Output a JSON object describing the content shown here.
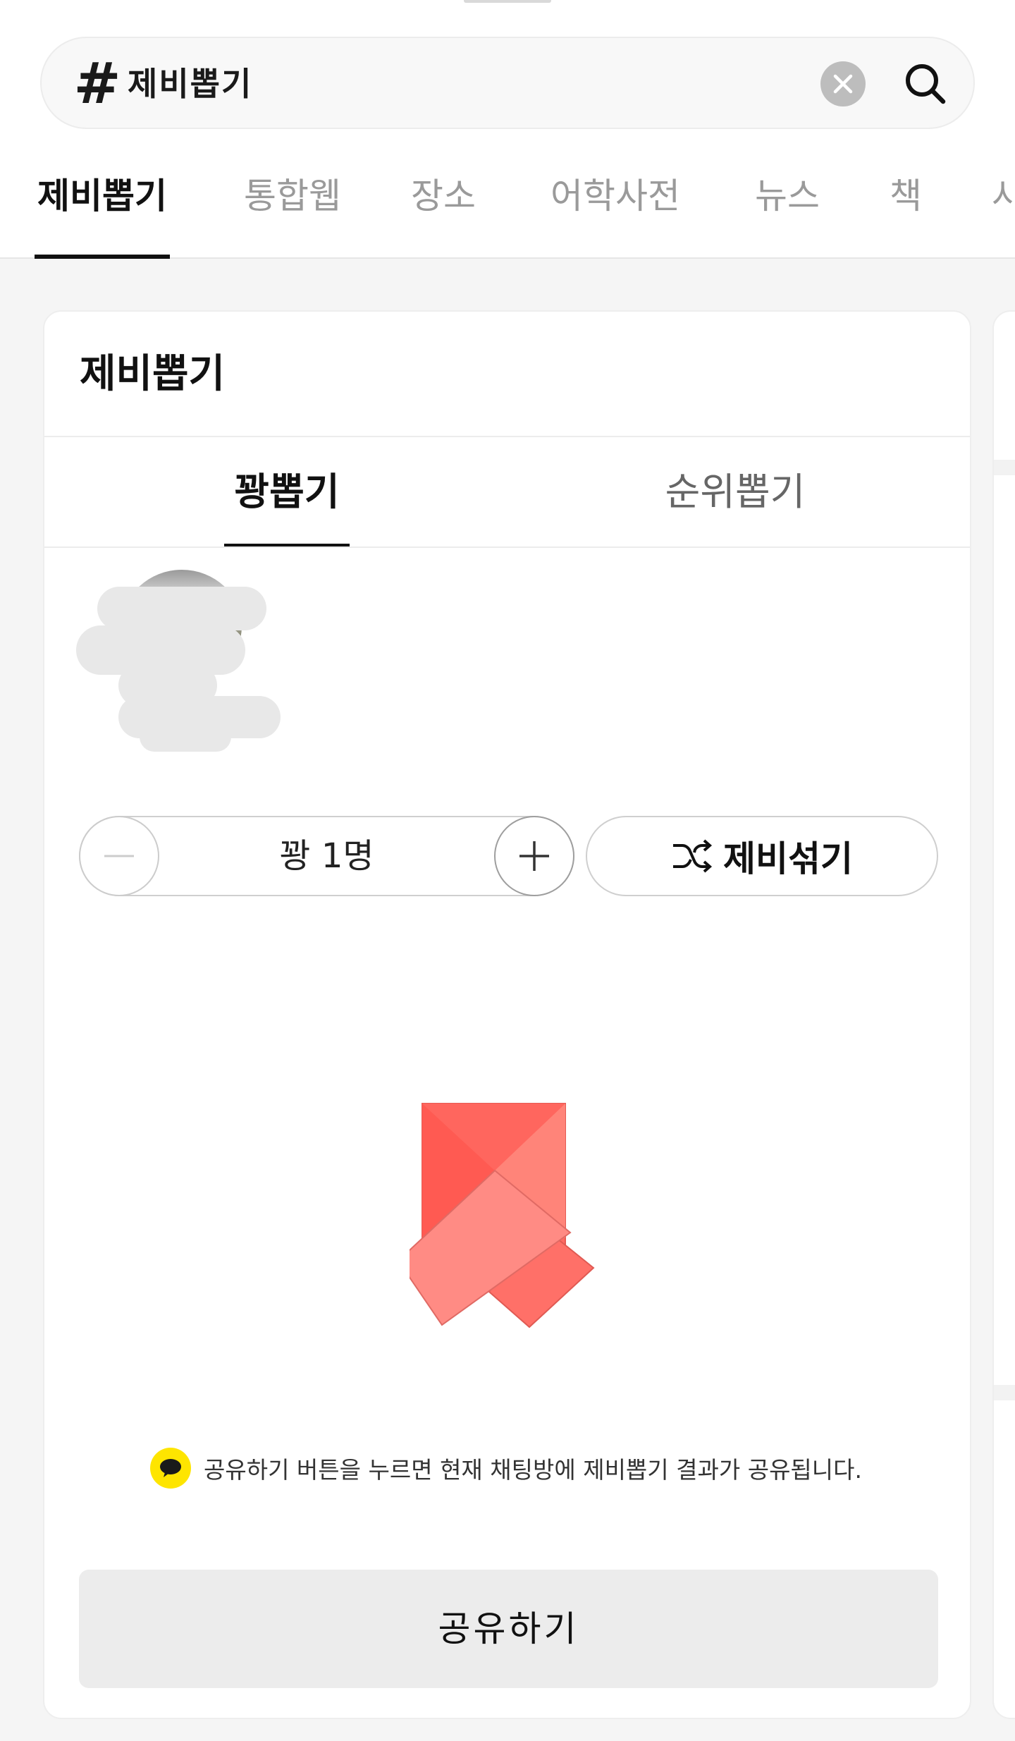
{
  "search": {
    "hash_symbol": "#",
    "query": "제비뽑기"
  },
  "tabs": [
    {
      "label": "제비뽑기",
      "active": true
    },
    {
      "label": "통합웹",
      "active": false
    },
    {
      "label": "장소",
      "active": false
    },
    {
      "label": "어학사전",
      "active": false
    },
    {
      "label": "뉴스",
      "active": false
    },
    {
      "label": "책",
      "active": false
    },
    {
      "label": "사",
      "active": false
    }
  ],
  "card": {
    "title": "제비뽑기",
    "mode_tabs": [
      {
        "label": "꽝뽑기",
        "active": true
      },
      {
        "label": "순위뽑기",
        "active": false
      }
    ],
    "stepper": {
      "value_label": "꽝 1명"
    },
    "shuffle_label": "제비섞기",
    "notice": "공유하기 버튼을 누르면 현재 채팅방에 제비뽑기 결과가 공유됩니다.",
    "share_label": "공유하기"
  },
  "colors": {
    "accent_yellow": "#fee500",
    "paper_red": "#ff5f57",
    "paper_light": "#ff8a84"
  },
  "icons": [
    "clear-icon",
    "search-icon",
    "minus-icon",
    "plus-icon",
    "shuffle-icon",
    "talk-bubble-icon"
  ]
}
